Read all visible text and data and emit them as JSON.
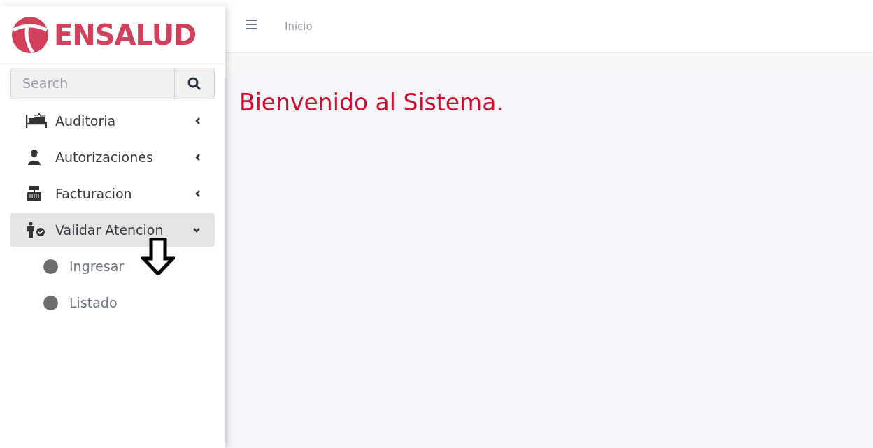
{
  "logo": {
    "text": "ENSALUD"
  },
  "search": {
    "placeholder": "Search"
  },
  "menu": [
    {
      "label": "Auditoria",
      "kind": "bed",
      "expanded": false
    },
    {
      "label": "Autorizaciones",
      "kind": "doctor",
      "expanded": false
    },
    {
      "label": "Facturacion",
      "kind": "register",
      "expanded": false
    },
    {
      "label": "Validar Atencion",
      "kind": "person-check",
      "expanded": true,
      "children": [
        {
          "label": "Ingresar"
        },
        {
          "label": "Listado"
        }
      ]
    }
  ],
  "header": {
    "breadcrumb": "Inicio"
  },
  "content": {
    "title": "Bienvenido al Sistema."
  }
}
